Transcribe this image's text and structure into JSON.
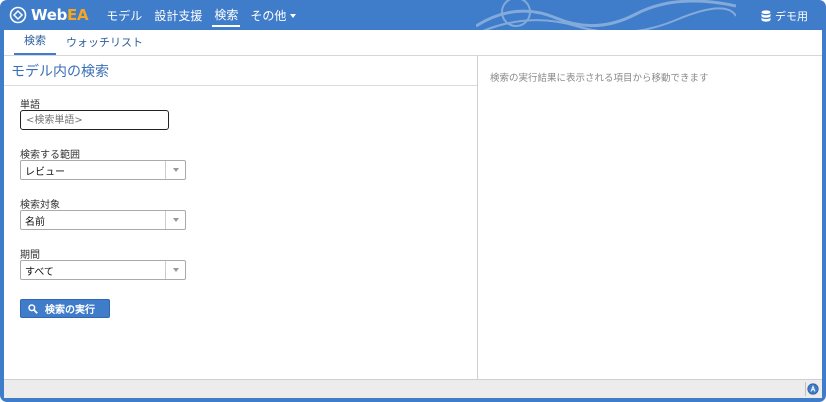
{
  "header": {
    "logo_text": "Web",
    "logo_accent": "EA",
    "nav": [
      "モデル",
      "設計支援",
      "検索",
      "その他"
    ],
    "active_nav": "検索",
    "user_label": "デモ用",
    "user_icon": "database-icon"
  },
  "tabs": [
    {
      "label": "検索",
      "active": true
    },
    {
      "label": "ウォッチリスト",
      "active": false
    }
  ],
  "search_panel": {
    "title": "モデル内の検索",
    "term_label": "単語",
    "term_placeholder": "<検索単語>",
    "term_value": "",
    "scope_label": "検索する範囲",
    "scope_value": "レビュー",
    "target_label": "検索対象",
    "target_value": "名前",
    "period_label": "期間",
    "period_value": "すべて",
    "execute_label": "検索の実行"
  },
  "results_panel": {
    "message": "検索の実行結果に表示される項目から移動できます"
  },
  "colors": {
    "brand_blue": "#3f7cc9",
    "logo_accent": "#f5a623",
    "title_blue": "#3a6fb7"
  }
}
